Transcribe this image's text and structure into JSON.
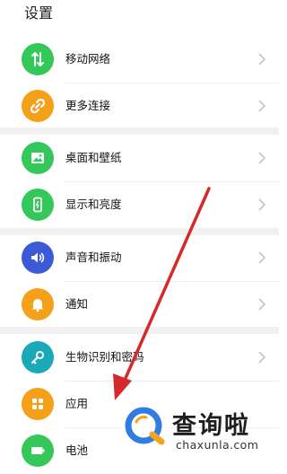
{
  "header": {
    "title": "设置"
  },
  "items": [
    {
      "label": "移动网络",
      "icon": "mobile-data-icon",
      "color": "#34c759"
    },
    {
      "label": "更多连接",
      "icon": "link-icon",
      "color": "#f4a019"
    },
    {
      "label": "桌面和壁纸",
      "icon": "wallpaper-icon",
      "color": "#34c759"
    },
    {
      "label": "显示和亮度",
      "icon": "display-icon",
      "color": "#34c759"
    },
    {
      "label": "声音和振动",
      "icon": "sound-icon",
      "color": "#3b5bd6"
    },
    {
      "label": "通知",
      "icon": "bell-icon",
      "color": "#f4a019"
    },
    {
      "label": "生物识别和密码",
      "icon": "key-icon",
      "color": "#1aa9b8"
    },
    {
      "label": "应用",
      "icon": "apps-icon",
      "color": "#f4a019"
    },
    {
      "label": "电池",
      "icon": "battery-icon",
      "color": "#34c759"
    }
  ],
  "watermark": {
    "main": "查询啦",
    "sub": "chaxunla.com"
  },
  "annotation": {
    "arrow_color": "#d42a2a"
  }
}
